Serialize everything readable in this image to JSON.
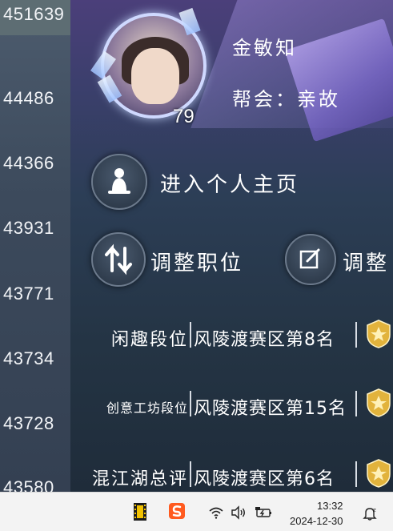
{
  "left_list": [
    "451639",
    "44486",
    "44366",
    "43931",
    "43771",
    "43734",
    "43728",
    "43580"
  ],
  "profile": {
    "name": "金敏知",
    "guild": "帮会：亲故",
    "level": "79"
  },
  "actions": {
    "home": "进入个人主页",
    "adjust_position": "调整职位",
    "adjust_other": "调整"
  },
  "rankings": [
    {
      "category": "闲趣段位",
      "result": "风陵渡赛区第8名"
    },
    {
      "category": "创意工坊段位",
      "result": "风陵渡赛区第15名"
    },
    {
      "category": "混江湖总评",
      "result": "风陵渡赛区第6名"
    }
  ],
  "taskbar": {
    "time": "13:32",
    "date": "2024-12-30"
  },
  "colors": {
    "badge_gold": "#e2b33c",
    "panel_purple": "#4b3f7a",
    "panel_dark": "#243444"
  }
}
